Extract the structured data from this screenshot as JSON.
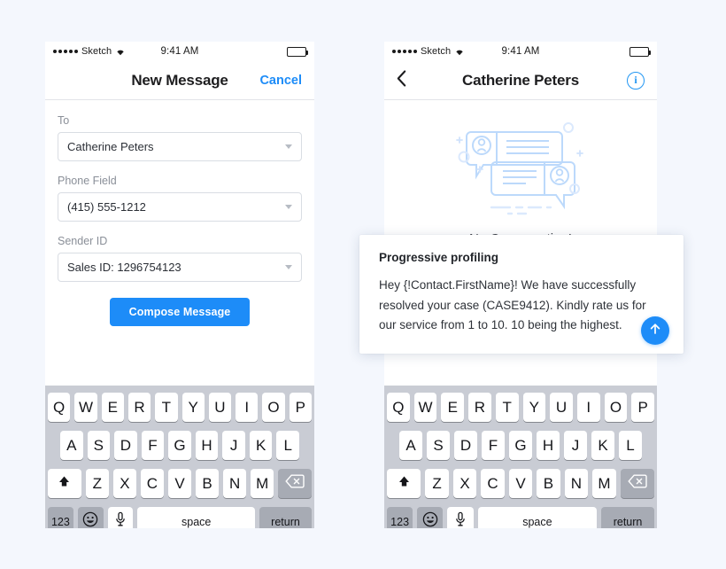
{
  "page": {
    "background_color": "#f4f7fd",
    "accent_color": "#1d8cf8"
  },
  "phone_left": {
    "status_bar": {
      "carrier": "Sketch",
      "time": "9:41 AM",
      "wifi_icon": "wifi-icon",
      "battery_icon": "battery-icon"
    },
    "nav": {
      "title": "New Message",
      "cancel_label": "Cancel"
    },
    "form": {
      "fields": [
        {
          "label": "To",
          "value": "Catherine Peters",
          "dropdown_icon": "chevron-down-icon"
        },
        {
          "label": "Phone Field",
          "value": "(415) 555-1212",
          "dropdown_icon": "chevron-down-icon"
        },
        {
          "label": "Sender ID",
          "value": "Sales ID: 1296754123",
          "dropdown_icon": "chevron-down-icon"
        }
      ],
      "compose_button": "Compose Message"
    }
  },
  "phone_right": {
    "status_bar": {
      "carrier": "Sketch",
      "time": "9:41 AM",
      "wifi_icon": "wifi-icon",
      "battery_icon": "battery-icon"
    },
    "nav": {
      "back_icon": "chevron-left-icon",
      "title": "Catherine Peters",
      "info_icon": "info-circle-icon",
      "info_glyph": "i"
    },
    "conversation": {
      "illustration": "empty-chat-bubbles-illustration",
      "empty_text": "No Conversation!"
    }
  },
  "message_card": {
    "title": "Progressive profiling",
    "body": "Hey {!Contact.FirstName}! We have successfully resolved your case (CASE9412). Kindly rate us for our service from 1 to 10. 10 being the highest.",
    "send_icon": "arrow-up-icon"
  },
  "keyboard": {
    "row1": [
      "Q",
      "W",
      "E",
      "R",
      "T",
      "Y",
      "U",
      "I",
      "O",
      "P"
    ],
    "row2": [
      "A",
      "S",
      "D",
      "F",
      "G",
      "H",
      "J",
      "K",
      "L"
    ],
    "row3": [
      "Z",
      "X",
      "C",
      "V",
      "B",
      "N",
      "M"
    ],
    "shift_icon": "shift-arrow-icon",
    "backspace_icon": "backspace-icon",
    "numeric_label": "123",
    "emoji_icon": "smiley-icon",
    "mic_icon": "microphone-icon",
    "space_label": "space",
    "return_label": "return"
  }
}
